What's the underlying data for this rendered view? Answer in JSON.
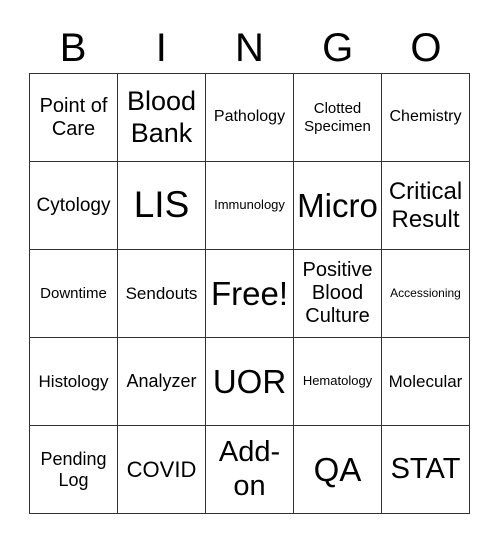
{
  "header": {
    "letters": [
      "B",
      "I",
      "N",
      "G",
      "O"
    ]
  },
  "cells": [
    {
      "text": "Point of Care",
      "size": "s20"
    },
    {
      "text": "Blood Bank",
      "size": "s26"
    },
    {
      "text": "Pathology",
      "size": "s16"
    },
    {
      "text": "Clotted Specimen",
      "size": "s15"
    },
    {
      "text": "Chemistry",
      "size": "s16"
    },
    {
      "text": "Cytology",
      "size": "s19"
    },
    {
      "text": "LIS",
      "size": "s36"
    },
    {
      "text": "Immunology",
      "size": "s13"
    },
    {
      "text": "Micro",
      "size": "s32"
    },
    {
      "text": "Critical Result",
      "size": "s24"
    },
    {
      "text": "Downtime",
      "size": "s15"
    },
    {
      "text": "Sendouts",
      "size": "s17"
    },
    {
      "text": "Free!",
      "size": "s32"
    },
    {
      "text": "Positive Blood Culture",
      "size": "s20"
    },
    {
      "text": "Accessioning",
      "size": "s12"
    },
    {
      "text": "Histology",
      "size": "s17"
    },
    {
      "text": "Analyzer",
      "size": "s18"
    },
    {
      "text": "UOR",
      "size": "s32"
    },
    {
      "text": "Hematology",
      "size": "s13"
    },
    {
      "text": "Molecular",
      "size": "s17"
    },
    {
      "text": "Pending Log",
      "size": "s18"
    },
    {
      "text": "COVID",
      "size": "s21"
    },
    {
      "text": "Add-on",
      "size": "s28"
    },
    {
      "text": "QA",
      "size": "s32"
    },
    {
      "text": "STAT",
      "size": "s28"
    }
  ]
}
